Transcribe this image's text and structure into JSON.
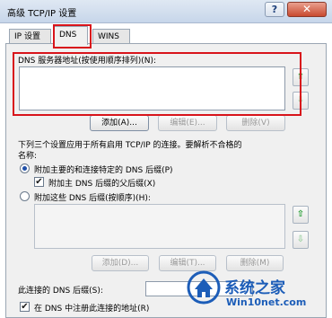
{
  "window": {
    "title": "高级 TCP/IP 设置",
    "help_glyph": "?",
    "close_glyph": "✕"
  },
  "tabs": [
    {
      "label": "IP 设置",
      "active": false
    },
    {
      "label": "DNS",
      "active": true
    },
    {
      "label": "WINS",
      "active": false
    }
  ],
  "dns_servers": {
    "label": "DNS 服务器地址(按使用顺序排列)(N):",
    "up_glyph": "⇧",
    "down_glyph": "⇩",
    "add_label": "添加(A)...",
    "edit_label": "编辑(E)...",
    "delete_label": "删除(V)"
  },
  "resolution": {
    "intro_line1": "下列三个设置应用于所有启用 TCP/IP 的连接。要解析不合格的",
    "intro_line2": "名称:",
    "append_primary_label": "附加主要的和连接特定的 DNS 后缀(P)",
    "append_parent_label": "附加主 DNS 后缀的父后缀(X)",
    "append_these_label": "附加这些 DNS 后缀(按顺序)(H):",
    "selected_option": "append_primary",
    "append_parent_checked": true,
    "add_label": "添加(D)...",
    "edit_label": "编辑(T)...",
    "delete_label": "删除(M)",
    "up_glyph": "⇧",
    "down_glyph": "⇩"
  },
  "connection": {
    "suffix_label": "此连接的 DNS 后缀(S):",
    "register_label": "在 DNS 中注册此连接的地址(R)",
    "register_checked": true
  },
  "watermark": {
    "brand": "系统之家",
    "url": "Win10net.com"
  },
  "colors": {
    "highlight_red": "#d8141b",
    "watermark_blue": "#1c5db8"
  }
}
